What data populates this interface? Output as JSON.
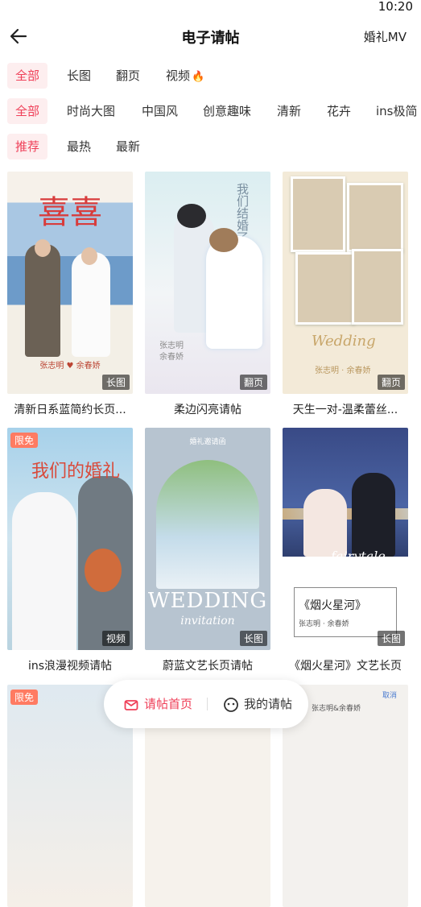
{
  "status_bar": {
    "time": "10:20"
  },
  "header": {
    "title": "电子请帖",
    "right_link": "婚礼MV"
  },
  "filters": {
    "format": [
      "全部",
      "长图",
      "翻页",
      "视频"
    ],
    "style": [
      "全部",
      "时尚大图",
      "中国风",
      "创意趣味",
      "清新",
      "花卉",
      "ins极简"
    ],
    "sort": [
      "推荐",
      "最热",
      "最新"
    ]
  },
  "cards": [
    {
      "title": "清新日系蓝简约长页...",
      "badge": "长图",
      "art": [
        "喜喜",
        "张志明 ♥ 余春娇"
      ]
    },
    {
      "title": "柔边闪亮请帖",
      "badge": "翻页",
      "art": [
        "我们结婚了",
        "张志明",
        "余春娇"
      ]
    },
    {
      "title": "天生一对-温柔蕾丝...",
      "badge": "翻页",
      "art": [
        "Wedding",
        "张志明 · 余春娇"
      ]
    },
    {
      "title": "ins浪漫视频请帖",
      "badge": "视频",
      "limited": "限免",
      "art": [
        "我们的婚礼"
      ]
    },
    {
      "title": "蔚蓝文艺长页请帖",
      "badge": "长图",
      "art": [
        "婚礼邀请函",
        "WEDDING",
        "invitation"
      ]
    },
    {
      "title": "《烟火星河》文艺长页",
      "badge": "长图",
      "art": [
        "fairytale",
        "《烟火星河》",
        "张志明 · 余春娇"
      ]
    },
    {
      "title": "",
      "limited": "限免"
    },
    {
      "title": ""
    },
    {
      "title": "",
      "art": [
        "张志明&余春娇",
        "取消"
      ]
    }
  ],
  "bottom_tabs": {
    "home": "请帖首页",
    "mine": "我的请帖"
  },
  "colors": {
    "accent": "#ef3f58",
    "chip_bg": "#fdeeef"
  }
}
